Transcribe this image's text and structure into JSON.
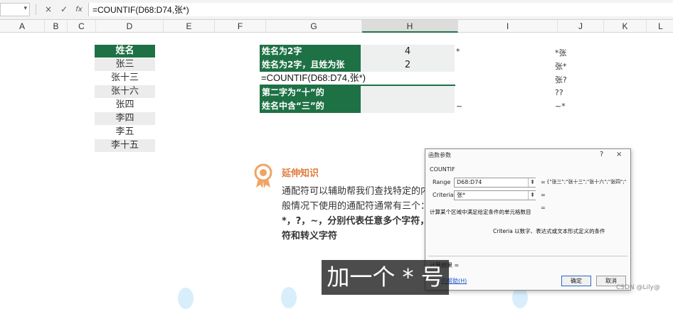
{
  "formula_bar": {
    "name_box": "",
    "buttons": [
      "×",
      "✓",
      "fx"
    ],
    "formula": "=COUNTIF(D68:D74,张*)"
  },
  "columns": [
    {
      "label": "A",
      "w": 63
    },
    {
      "label": "B",
      "w": 32
    },
    {
      "label": "C",
      "w": 40
    },
    {
      "label": "D",
      "w": 95
    },
    {
      "label": "E",
      "w": 72
    },
    {
      "label": "F",
      "w": 72
    },
    {
      "label": "G",
      "w": 135
    },
    {
      "label": "H",
      "w": 135
    },
    {
      "label": "I",
      "w": 140
    },
    {
      "label": "J",
      "w": 65
    },
    {
      "label": "K",
      "w": 60
    },
    {
      "label": "L",
      "w": 40
    }
  ],
  "name_table": {
    "header": "姓名",
    "rows": [
      "张三",
      "张十三",
      "张十六",
      "张四",
      "李四",
      "李五",
      "李十五"
    ]
  },
  "criteria_table": {
    "rows": [
      {
        "label": "姓名为2字",
        "value": "4",
        "wildcard": "*",
        "pattern": "*张"
      },
      {
        "label": "姓名为2字，且姓为张",
        "value": "2",
        "wildcard": "",
        "pattern": "张*"
      },
      {
        "label": "",
        "value": "",
        "wildcard": "",
        "pattern": "张?"
      },
      {
        "label": "第二字为“十”的",
        "value": "",
        "wildcard": "",
        "pattern": "??"
      },
      {
        "label": "姓名中含“三”的",
        "value": "",
        "wildcard": "~",
        "pattern": "~*"
      }
    ],
    "editing_formula": "=COUNTIF(D68:D74,张*)"
  },
  "knowledge": {
    "title": "延伸知识",
    "line1": "通配符可以辅助帮我们查找特定的内容",
    "line2": "般情况下使用的通配符通常有三个：",
    "line3_prefix": "*，?，~，分别代表",
    "line3_bold": "任意多个字符，",
    "line3_tail": "—",
    "line4_prefix": "符和",
    "line4_bold": "转义字符"
  },
  "dialog": {
    "title": "函数参数",
    "help_button": "?",
    "close_button": "×",
    "function_name": "COUNTIF",
    "range_label": "Range",
    "range_value": "D68:D74",
    "range_result": "{\"张三\";\"张十三\";\"张十六\";\"张四\";\"",
    "criteria_label": "Criteria",
    "criteria_value": "张*",
    "equals": "=",
    "description": "计算某个区域中满足给定条件的单元格数目",
    "criteria_desc": "Criteria   以数字、表达式或文本形式定义的条件",
    "calc_result": "计算结果 =",
    "help_link": "的帮助(H)",
    "ok": "确定",
    "cancel": "取消"
  },
  "subtitle": "加一个 * 号",
  "watermark": "CSDN @Lily@",
  "colors": {
    "accent_green": "#1e7145",
    "orange": "#e07a3c"
  }
}
